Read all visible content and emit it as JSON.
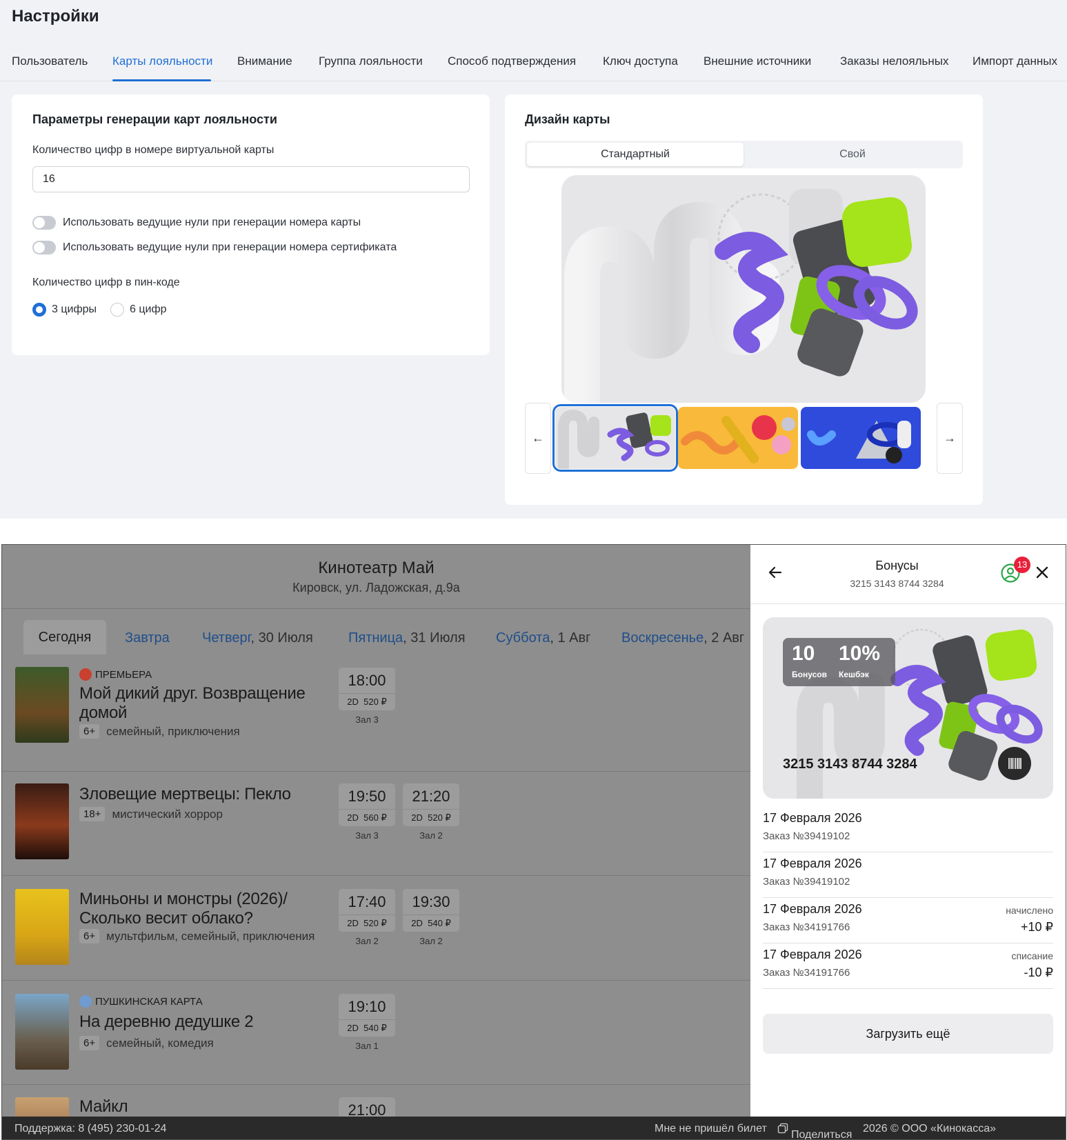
{
  "settings": {
    "title": "Настройки",
    "tabs": [
      "Пользователь",
      "Карты лояльности",
      "Внимание",
      "Группа лояльности",
      "Способ подтверждения",
      "Ключ доступа",
      "Внешние источники",
      "Заказы нелояльных",
      "Импорт данных"
    ],
    "active_tab": "Карты лояльности",
    "generation": {
      "title": "Параметры генерации карт лояльности",
      "digits_label": "Количество цифр в номере виртуальной карты",
      "digits_value": "16",
      "toggle_card": "Использовать ведущие нули при генерации номера карты",
      "toggle_cert": "Использовать ведущие нули при генерации номера сертификата",
      "pin_label": "Количество цифр в пин-коде",
      "pin_options": [
        "3 цифры",
        "6 цифр"
      ],
      "pin_selected": "3 цифры"
    },
    "design": {
      "title": "Дизайн карты",
      "segments": [
        "Стандартный",
        "Свой"
      ],
      "segment_selected": "Стандартный",
      "thumbnails": [
        "grey-abstract",
        "yellow-abstract",
        "blue-abstract"
      ],
      "thumbnail_selected": "grey-abstract"
    },
    "colors": {
      "accent": "#1f6fd6",
      "lime": "#a5e31a",
      "purple": "#7c5ce0"
    }
  },
  "kiosk": {
    "cinema_name": "Кинотеатр Май",
    "cinema_address": "Кировск, ул. Ладожская, д.9а",
    "day_tabs": [
      {
        "day": "Сегодня",
        "date": ""
      },
      {
        "day": "Завтра",
        "date": ""
      },
      {
        "day": "Четверг",
        "date": ", 30 Июля"
      },
      {
        "day": "Пятница",
        "date": ", 31 Июля"
      },
      {
        "day": "Суббота",
        "date": ", 1 Авг"
      },
      {
        "day": "Воскресенье",
        "date": ", 2 Авг"
      }
    ],
    "movies": [
      {
        "badge": "ПРЕМЬЕРА",
        "badge_icon": "premiere-icon",
        "title1": "Мой дикий друг. Возвращение",
        "title2": "домой",
        "age": "6+",
        "genres": "семейный, приключения",
        "sessions": [
          {
            "time": "18:00",
            "format": "2D",
            "price": "520 ₽",
            "hall": "Зал 3"
          }
        ]
      },
      {
        "badge": "",
        "title1": "Зловещие мертвецы: Пекло",
        "title2": "",
        "age": "18+",
        "genres": "мистический хоррор",
        "sessions": [
          {
            "time": "19:50",
            "format": "2D",
            "price": "560 ₽",
            "hall": "Зал 3"
          },
          {
            "time": "21:20",
            "format": "2D",
            "price": "520 ₽",
            "hall": "Зал 2"
          }
        ]
      },
      {
        "badge": "",
        "title1": "Миньоны и монстры (2026)/",
        "title2": "Сколько весит облако?",
        "age": "6+",
        "genres": "мультфильм, семейный, приключения",
        "sessions": [
          {
            "time": "17:40",
            "format": "2D",
            "price": "520 ₽",
            "hall": "Зал 2"
          },
          {
            "time": "19:30",
            "format": "2D",
            "price": "540 ₽",
            "hall": "Зал 2"
          }
        ]
      },
      {
        "badge": "ПУШКИНСКАЯ КАРТА",
        "badge_icon": "pushkin-card-icon",
        "title1": "На деревню дедушке 2",
        "title2": "",
        "age": "6+",
        "genres": "семейный, комедия",
        "sessions": [
          {
            "time": "19:10",
            "format": "2D",
            "price": "540 ₽",
            "hall": "Зал 1"
          }
        ]
      },
      {
        "badge": "",
        "title1": "Майкл",
        "title2": "",
        "age": "",
        "genres": "",
        "sessions": [
          {
            "time": "21:00",
            "format": "",
            "price": "",
            "hall": ""
          }
        ]
      }
    ],
    "footer": {
      "support": "Поддержка: 8 (495) 230-01-24",
      "no_ticket": "Мне не пришёл билет",
      "share": "Поделиться",
      "copyright": "2026 © ООО «Кинокасса»"
    },
    "bonus_panel": {
      "title": "Бонусы",
      "card_number_header": "3215 3143 8744 3284",
      "notification_count": "13",
      "bonuses_value": "10",
      "bonuses_label": "Бонусов",
      "cashback_value": "10%",
      "cashback_label": "Кешбэк",
      "card_number": "3215 3143 8744 3284",
      "transactions": [
        {
          "date": "17 Февраля 2026",
          "order": "Заказ №39419102",
          "kind": "",
          "amount": ""
        },
        {
          "date": "17 Февраля 2026",
          "order": "Заказ №39419102",
          "kind": "",
          "amount": ""
        },
        {
          "date": "17 Февраля 2026",
          "order": "Заказ №34191766",
          "kind": "начислено",
          "amount": "+10 ₽"
        },
        {
          "date": "17 Февраля 2026",
          "order": "Заказ №34191766",
          "kind": "списание",
          "amount": "-10 ₽"
        }
      ],
      "load_more": "Загрузить ещё"
    }
  }
}
